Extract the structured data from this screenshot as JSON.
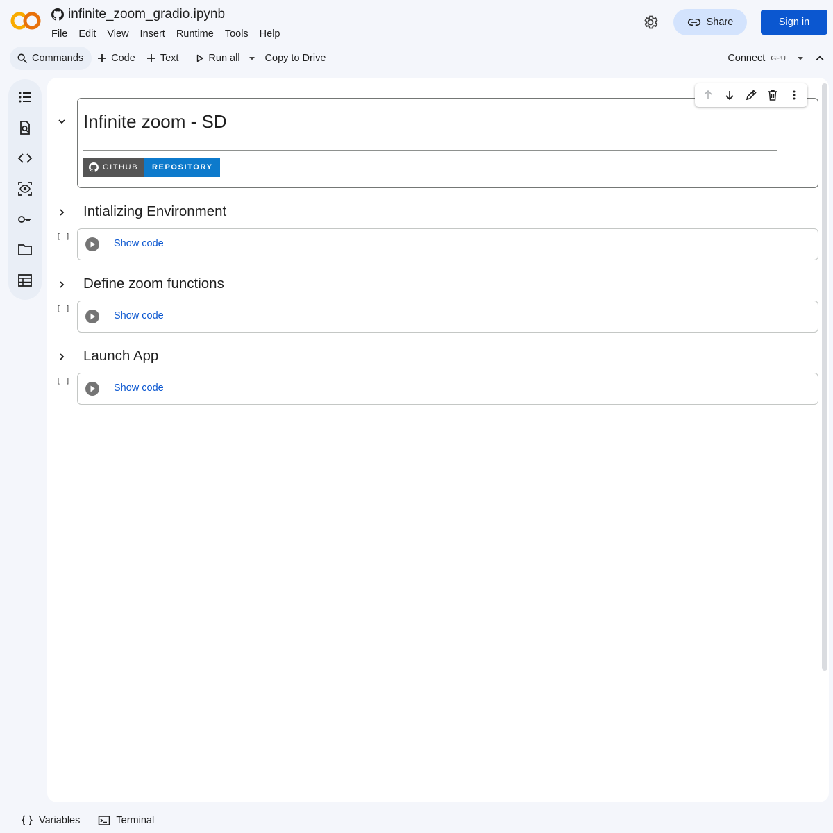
{
  "header": {
    "doc_title": "infinite_zoom_gradio.ipynb",
    "menu": [
      "File",
      "Edit",
      "View",
      "Insert",
      "Runtime",
      "Tools",
      "Help"
    ],
    "share_label": "Share",
    "signin_label": "Sign in"
  },
  "toolbar": {
    "commands_label": "Commands",
    "code_label": "Code",
    "text_label": "Text",
    "run_all_label": "Run all",
    "copy_to_drive_label": "Copy to Drive",
    "connect_label": "Connect",
    "gpu_label": "GPU"
  },
  "rail_icons": [
    "table-of-contents-icon",
    "find-replace-icon",
    "code-snippets-icon",
    "variables-inspector-icon",
    "secrets-key-icon",
    "files-folder-icon",
    "data-table-icon"
  ],
  "notebook": {
    "title_cell": {
      "heading": "Infinite zoom - SD",
      "badge_left": "GITHUB",
      "badge_right": "REPOSITORY"
    },
    "sections": [
      {
        "heading": "Intializing Environment",
        "exec_count": "[ ]",
        "show_code": "Show code"
      },
      {
        "heading": "Define zoom functions",
        "exec_count": "[ ]",
        "show_code": "Show code"
      },
      {
        "heading": "Launch App",
        "exec_count": "[ ]",
        "show_code": "Show code"
      }
    ]
  },
  "bottombar": {
    "variables_label": "Variables",
    "terminal_label": "Terminal"
  },
  "colors": {
    "accent": "#0b57d0",
    "share_bg": "#d3e3fd",
    "logo_orange": "#f9ab00",
    "logo_dark_orange": "#e8710a",
    "badge_blue": "#0d7acc",
    "badge_gray": "#555555"
  }
}
